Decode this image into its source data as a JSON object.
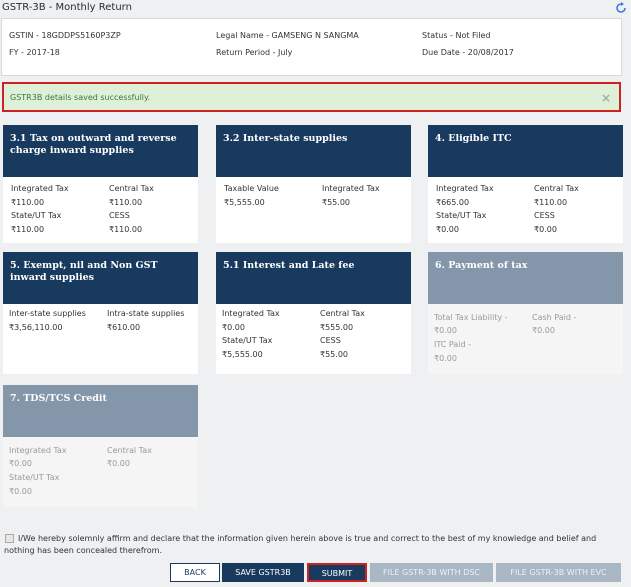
{
  "title": "GSTR-3B - Monthly Return",
  "info": {
    "gstin": "GSTIN - 18GDDPS5160P3ZP",
    "legal_name": "Legal Name - GAMSENG N SANGMA",
    "status": "Status - Not Filed",
    "fy": "FY - 2017-18",
    "return_period": "Return Period - July",
    "due_date": "Due Date - 20/08/2017"
  },
  "alert": {
    "message": "GSTR3B details saved successfully.",
    "close": "×"
  },
  "cards": {
    "c31": {
      "title": "3.1 Tax on outward and reverse charge inward supplies",
      "l1": "Integrated Tax",
      "v1": "₹110.00",
      "l2": "Central Tax",
      "v2": "₹110.00",
      "l3": "State/UT Tax",
      "v3": "₹110.00",
      "l4": "CESS",
      "v4": "₹110.00"
    },
    "c32": {
      "title": "3.2 Inter-state supplies",
      "l1": "Taxable Value",
      "v1": "₹5,555.00",
      "l2": "Integrated Tax",
      "v2": "₹55.00"
    },
    "c4": {
      "title": "4. Eligible ITC",
      "l1": "Integrated Tax",
      "v1": "₹665.00",
      "l2": "Central Tax",
      "v2": "₹110.00",
      "l3": "State/UT Tax",
      "v3": "₹0.00",
      "l4": "CESS",
      "v4": "₹0.00"
    },
    "c5": {
      "title": "5. Exempt, nil and Non GST inward supplies",
      "l1": "Inter-state supplies",
      "v1": "₹3,56,110.00",
      "l2": "Intra-state supplies",
      "v2": "₹610.00"
    },
    "c51": {
      "title": "5.1 Interest and Late fee",
      "l1": "Integrated Tax",
      "v1": "₹0.00",
      "l2": "Central Tax",
      "v2": "₹555.00",
      "l3": "State/UT Tax",
      "v3": "₹5,555.00",
      "l4": "CESS",
      "v4": "₹55.00"
    },
    "c6": {
      "title": "6. Payment of tax",
      "l1": "Total Tax Liability -",
      "v1": "₹0.00",
      "l2": "Cash Paid -",
      "v2": "₹0.00",
      "l3": "ITC Paid -",
      "v3": "₹0.00"
    },
    "c7": {
      "title": "7. TDS/TCS Credit",
      "l1": "Integrated Tax",
      "v1": "₹0.00",
      "l2": "Central Tax",
      "v2": "₹0.00",
      "l3": "State/UT Tax",
      "v3": "₹0.00"
    }
  },
  "declaration": "I/We hereby solemnly affirm and declare that the information given herein above is true and correct to the best of my knowledge and belief and nothing has been concealed therefrom.",
  "buttons": {
    "back": "BACK",
    "save": "SAVE GSTR3B",
    "submit": "SUBMIT",
    "file_dsc": "FILE GSTR-3B WITH DSC",
    "file_evc": "FILE GSTR-3B WITH EVC"
  },
  "colors": {
    "header": "#183a5e",
    "header_disabled": "#8496a9",
    "alert_bg": "#dff0d8",
    "alert_border": "#cc2222"
  }
}
